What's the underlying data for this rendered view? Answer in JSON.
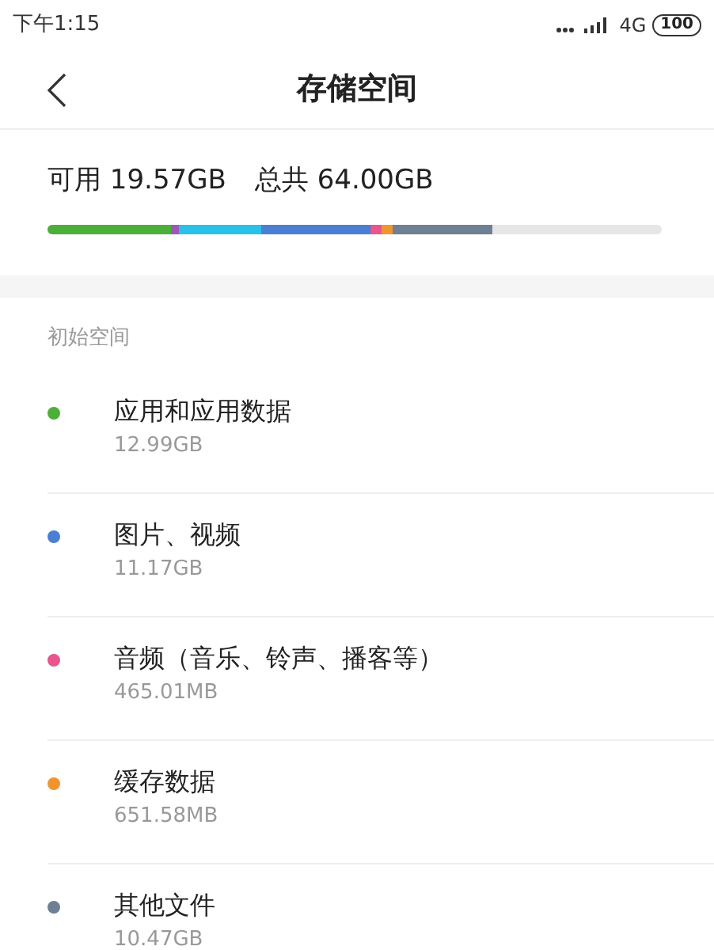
{
  "status_bar": {
    "time": "下午1:15",
    "network": "4G",
    "battery": "100"
  },
  "header": {
    "title": "存储空间"
  },
  "summary": {
    "available": "可用 19.57GB",
    "total": "总共 64.00GB"
  },
  "usage_bar": {
    "segments": [
      {
        "color": "#4caf3a"
      },
      {
        "color": "#9b59b6"
      },
      {
        "color": "#29c1ea"
      },
      {
        "color": "#4a7fd4"
      },
      {
        "color": "#e8558f"
      },
      {
        "color": "#f0952e"
      },
      {
        "color": "#6f7f94"
      }
    ]
  },
  "section_label": "初始空间",
  "categories": [
    {
      "name": "应用和应用数据",
      "size": "12.99GB",
      "color": "#4caf3a"
    },
    {
      "name": "图片、视频",
      "size": "11.17GB",
      "color": "#4a7fd4"
    },
    {
      "name": "音频（音乐、铃声、播客等）",
      "size": "465.01MB",
      "color": "#e8558f"
    },
    {
      "name": "缓存数据",
      "size": "651.58MB",
      "color": "#f0952e"
    },
    {
      "name": "其他文件",
      "size": "10.47GB",
      "color": "#6f7f94"
    }
  ]
}
